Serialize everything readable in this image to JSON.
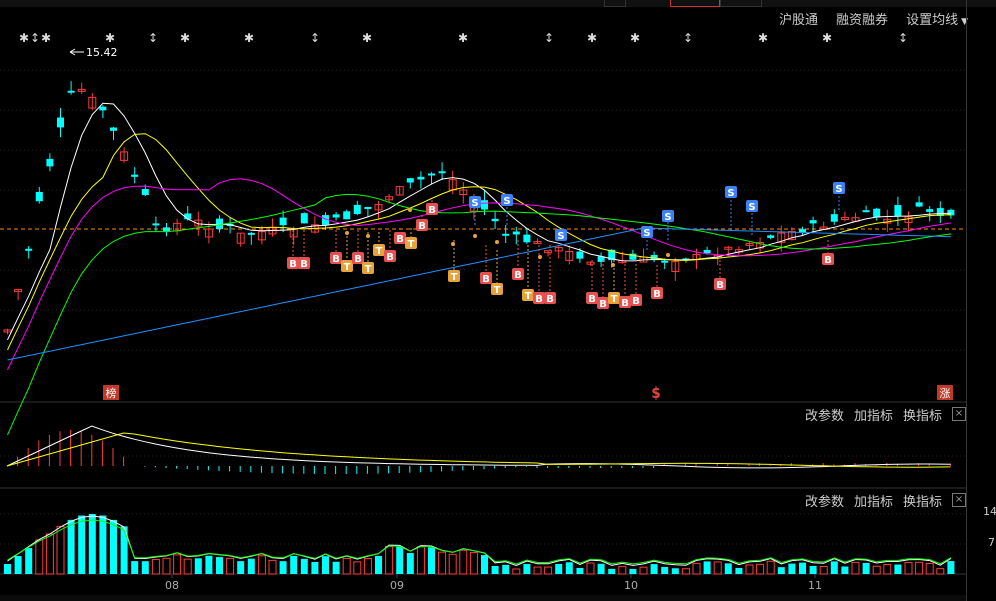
{
  "toolbar": {
    "hgt_label": "沪股通",
    "margin_label": "融资融券",
    "ma_settings_label": "设置均线"
  },
  "price_panel": {
    "peak_label": "15.42",
    "badge_bang": "榜",
    "badge_zhang": "涨",
    "s_marker": "S"
  },
  "macd_panel": {
    "edit_params": "改参数",
    "add_indicator": "加指标",
    "switch_indicator": "换指标",
    "close": "×"
  },
  "vol_panel": {
    "edit_params": "改参数",
    "add_indicator": "加指标",
    "switch_indicator": "换指标",
    "close": "×",
    "scale_top": "14",
    "scale_mid": "7"
  },
  "x_axis": [
    "08",
    "09",
    "10",
    "11"
  ],
  "colors": {
    "up": "#ff3b3b",
    "down": "#00ffff",
    "ma5": "#ffffff",
    "ma10": "#ffff00",
    "ma20": "#ff00ff",
    "ma30": "#00ff00",
    "ma60": "#1e90ff",
    "signal_b": "#e85050",
    "signal_t": "#e8a23a",
    "signal_s": "#3b82f6"
  }
}
